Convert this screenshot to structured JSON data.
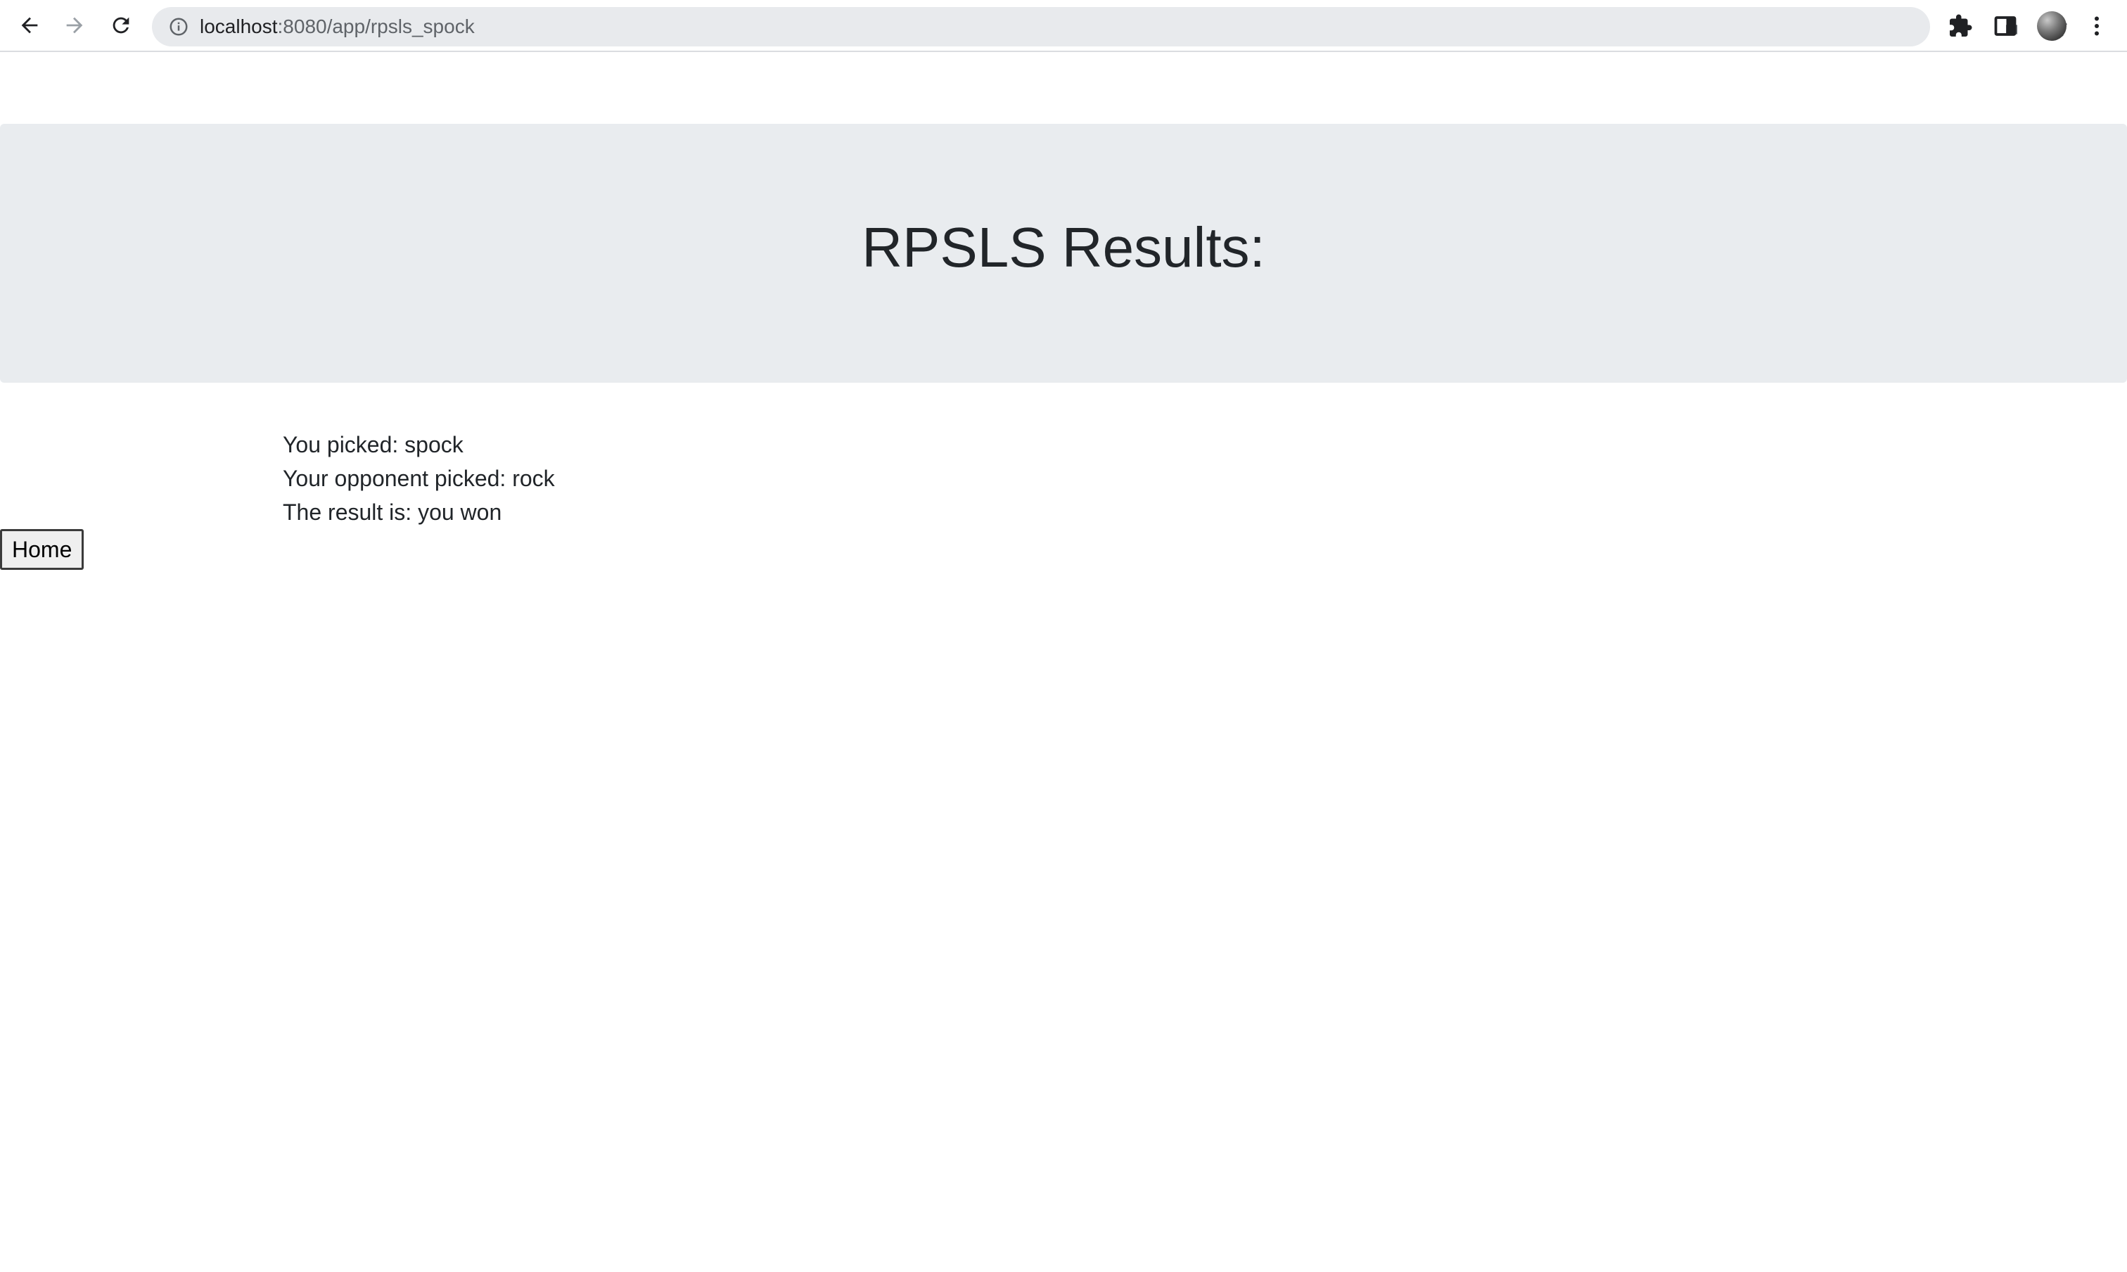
{
  "browser": {
    "url_host": "localhost",
    "url_rest": ":8080/app/rpsls_spock",
    "icons": [
      "back-arrow-icon",
      "forward-arrow-icon",
      "reload-icon",
      "site-info-icon",
      "share-icon",
      "bookmark-star-icon",
      "extensions-puzzle-icon",
      "side-panel-icon",
      "avatar",
      "kebab-menu-icon"
    ]
  },
  "hero": {
    "title": "RPSLS Results:"
  },
  "results": {
    "you_picked": "You picked: spock",
    "opponent_picked": "Your opponent picked: rock",
    "result": "The result is: you won"
  },
  "actions": {
    "home_label": "Home"
  },
  "colors": {
    "hero_background": "#e9ecef",
    "text": "#212529",
    "omnibox_background": "#e8eaed"
  }
}
